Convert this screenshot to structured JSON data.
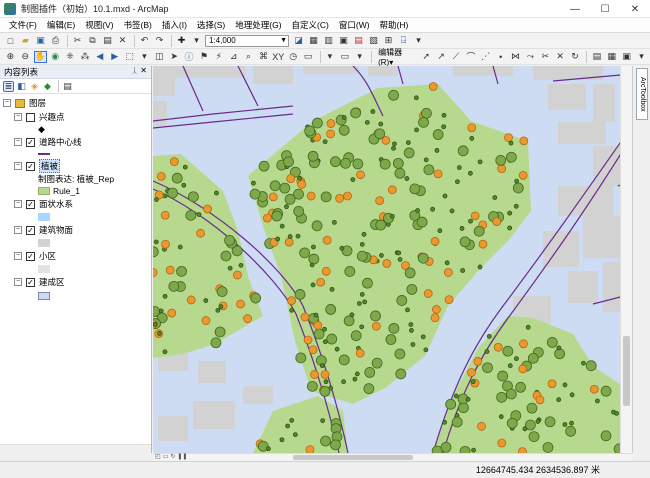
{
  "window": {
    "title": "制图插件（初始）10.1.mxd - ArcMap",
    "minimize": "—",
    "maximize": "☐",
    "close": "✕"
  },
  "menu": [
    "文件(F)",
    "编辑(E)",
    "视图(V)",
    "书签(B)",
    "插入(I)",
    "选择(S)",
    "地理处理(G)",
    "自定义(C)",
    "窗口(W)",
    "帮助(H)"
  ],
  "toolbar": {
    "scale": "1:4,000",
    "editor_label": "编辑器(R)▾"
  },
  "toc": {
    "title": "内容列表",
    "pin": "ᛸ",
    "close": "✕",
    "root": "图层",
    "layers": [
      {
        "name": "兴趣点",
        "checked": false
      },
      {
        "name": "道路中心线",
        "checked": true
      },
      {
        "name": "植被",
        "checked": true,
        "representation": "制图表达: 植被_Rep",
        "rule": "Rule_1"
      },
      {
        "name": "面状水系",
        "checked": true
      },
      {
        "name": "建筑物面",
        "checked": true
      },
      {
        "name": "小区",
        "checked": true
      },
      {
        "name": "建成区",
        "checked": true
      }
    ]
  },
  "right_dock": {
    "toolbox_tab": "ArcToolbox"
  },
  "status": {
    "coordinates": "12664745.434  2634536.897 米"
  },
  "colors": {
    "water": "#cddcf3",
    "vegetation": "#b7d98e",
    "building": "#d2d2d2",
    "road": "#6a2a8c",
    "tree_dark": "#4f8a2a",
    "tree_orange": "#e89a2c"
  }
}
